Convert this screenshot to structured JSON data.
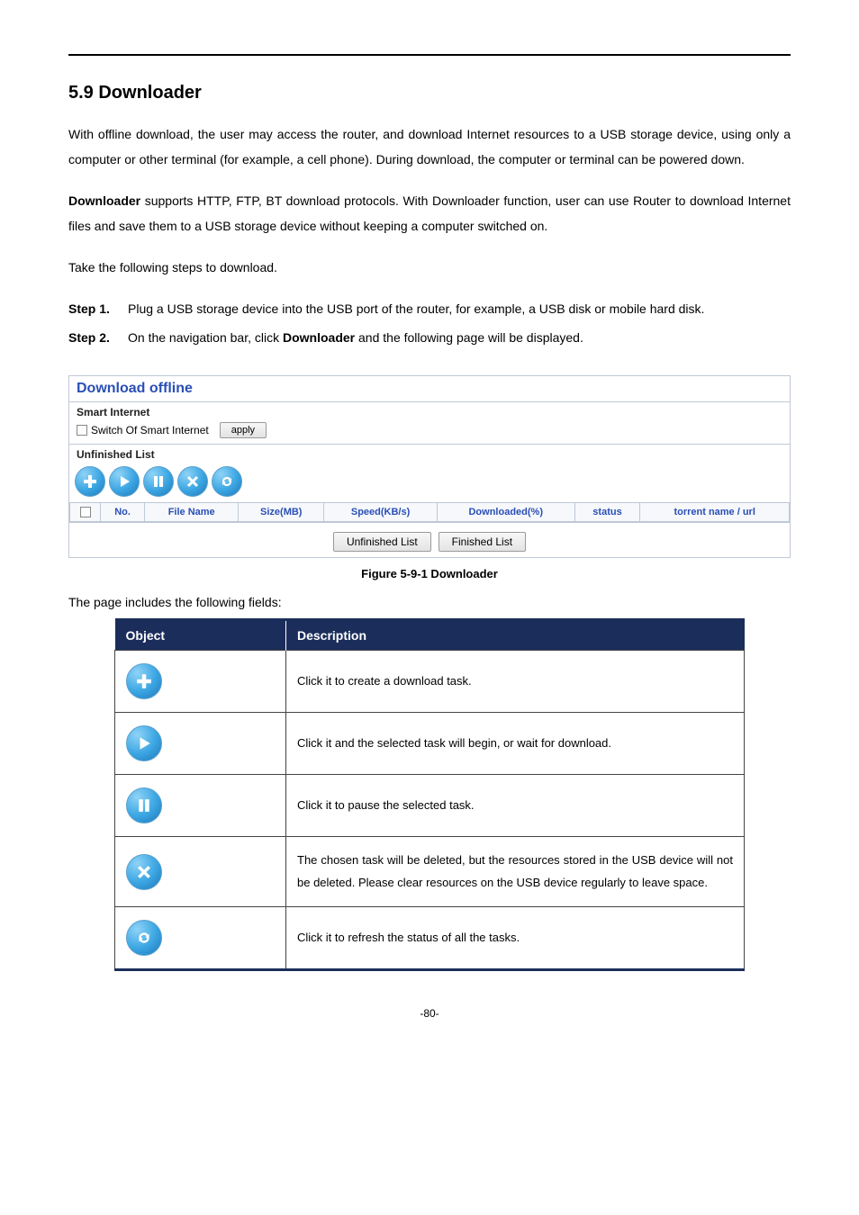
{
  "heading": "5.9  Downloader",
  "paragraphs": {
    "p1": "With offline download, the user may access the router, and download Internet resources to a USB storage device, using only a computer or other terminal (for example, a cell phone). During download, the computer or terminal can be powered down.",
    "p2_prefix": "Downloader",
    "p2_rest": " supports HTTP, FTP, BT download protocols. With Downloader function, user can use Router to download Internet files and save them to a USB storage device without keeping a computer switched on.",
    "p3": "Take the following steps to download."
  },
  "steps": [
    {
      "label": "Step 1.",
      "text": "Plug a USB storage device into the USB port of the router, for example, a USB disk or mobile hard disk."
    },
    {
      "label": "Step 2.",
      "pre": "On the navigation bar, click ",
      "bold": "Downloader",
      "post": " and the following page will be displayed."
    }
  ],
  "screenshot": {
    "title": "Download offline",
    "smart_internet_heading": "Smart Internet",
    "smart_internet_checkbox_label": "Switch Of Smart Internet",
    "apply_label": "apply",
    "unfinished_heading": "Unfinished List",
    "columns": [
      "No.",
      "File Name",
      "Size(MB)",
      "Speed(KB/s)",
      "Downloaded(%)",
      "status",
      "torrent name / url"
    ],
    "tab_unfinished": "Unfinished List",
    "tab_finished": "Finished List"
  },
  "figure_caption": "Figure 5-9-1 Downloader",
  "fields_intro": "The page includes the following fields:",
  "obj_table": {
    "header_object": "Object",
    "header_description": "Description",
    "rows": [
      {
        "icon": "plus",
        "desc": "Click it to create a download task."
      },
      {
        "icon": "play",
        "desc": "Click it and the selected task will begin, or wait for download."
      },
      {
        "icon": "pause",
        "desc": "Click it to pause the selected task."
      },
      {
        "icon": "close",
        "desc": "The chosen task will be deleted, but the resources stored in the USB device will not be deleted. Please clear resources on the USB device regularly to leave space."
      },
      {
        "icon": "refresh",
        "desc": "Click it to refresh the status of all the tasks."
      }
    ]
  },
  "page_number": "-80-"
}
